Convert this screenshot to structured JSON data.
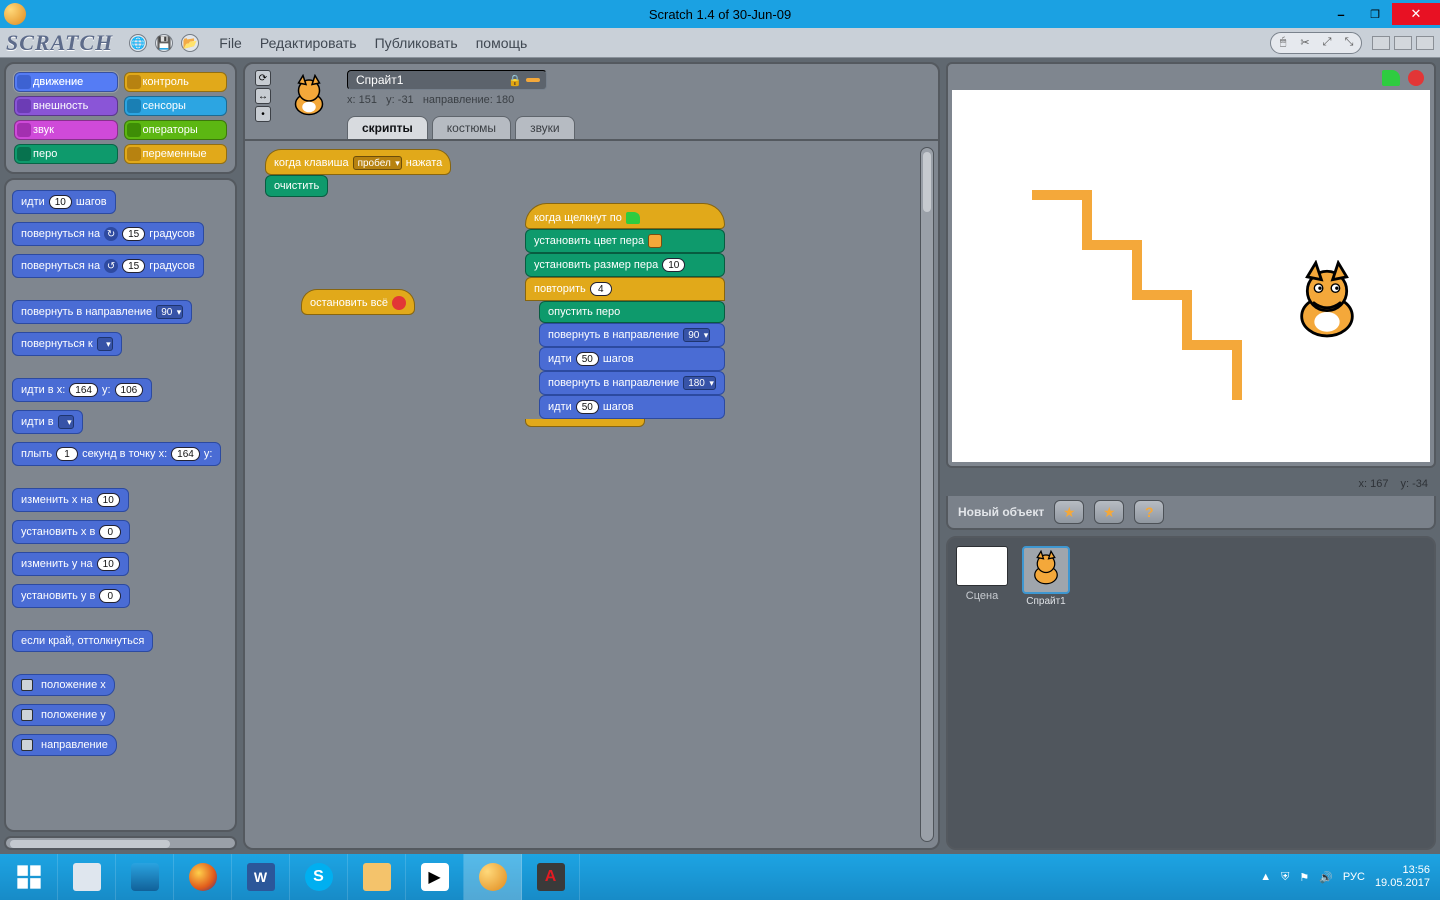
{
  "window": {
    "title": "Scratch 1.4 of 30-Jun-09"
  },
  "menu": {
    "file": "File",
    "edit": "Редактировать",
    "publish": "Публиковать",
    "help": "помощь"
  },
  "logo": "SCRATCH",
  "categories": [
    {
      "label": "движение",
      "bg": "#4a6cd4",
      "chip": "#3555b7",
      "active": true
    },
    {
      "label": "контроль",
      "bg": "#e1a91a",
      "chip": "#b78210"
    },
    {
      "label": "внешность",
      "bg": "#8a55d7",
      "chip": "#6c3cb5"
    },
    {
      "label": "сенсоры",
      "bg": "#2ca5e2",
      "chip": "#1a7fb4"
    },
    {
      "label": "звук",
      "bg": "#cf4ad9",
      "chip": "#a32fb0"
    },
    {
      "label": "операторы",
      "bg": "#5cb712",
      "chip": "#3e8d06"
    },
    {
      "label": "перо",
      "bg": "#0e9a6c",
      "chip": "#07724e"
    },
    {
      "label": "переменные",
      "bg": "#e1a91a",
      "chip": "#b78210"
    }
  ],
  "palette": {
    "move_steps": {
      "pre": "идти",
      "val": "10",
      "post": "шагов"
    },
    "turn_cw": {
      "pre": "повернуться на",
      "val": "15",
      "post": "градусов"
    },
    "turn_ccw": {
      "pre": "повернуться на",
      "val": "15",
      "post": "градусов"
    },
    "point_dir": {
      "pre": "повернуть в направление",
      "val": "90"
    },
    "point_towards": {
      "pre": "повернуться к",
      "dd": " "
    },
    "goto_xy": {
      "pre": "идти в x:",
      "x": "164",
      "mid": "y:",
      "y": "106"
    },
    "goto": {
      "pre": "идти в",
      "dd": " "
    },
    "glide": {
      "pre": "плыть",
      "sec": "1",
      "mid": "секунд в точку x:",
      "x": "164",
      "end": "y:"
    },
    "change_x": {
      "pre": "изменить x на",
      "val": "10"
    },
    "set_x": {
      "pre": "установить x в",
      "val": "0"
    },
    "change_y": {
      "pre": "изменить y на",
      "val": "10"
    },
    "set_y": {
      "pre": "установить y в",
      "val": "0"
    },
    "bounce": {
      "txt": "если край, оттолкнуться"
    },
    "rep_x": {
      "txt": "положение x"
    },
    "rep_y": {
      "txt": "положение y"
    },
    "rep_dir": {
      "txt": "направление"
    }
  },
  "sprite": {
    "name": "Спрайт1",
    "x": "151",
    "y": "-31",
    "dir": "180",
    "coord_tpl_x": "x:",
    "coord_tpl_y": "y:",
    "coord_tpl_dir": "направление:"
  },
  "tabs": {
    "scripts": "скрипты",
    "costumes": "костюмы",
    "sounds": "звуки"
  },
  "scripts": {
    "s1": {
      "hat_pre": "когда клавиша",
      "hat_dd": "пробел",
      "hat_post": "нажата",
      "clear": "очистить"
    },
    "s2": {
      "stop": "остановить всё"
    },
    "s3": {
      "hat": "когда щелкнут по",
      "setcolor": "установить цвет пера",
      "setsize_pre": "установить размер пера",
      "setsize_val": "10",
      "repeat_pre": "повторить",
      "repeat_val": "4",
      "pendown": "опустить перо",
      "point_pre": "повернуть в направление",
      "point1": "90",
      "point2": "180",
      "move_pre": "идти",
      "move_val": "50",
      "move_post": "шагов"
    }
  },
  "stage": {
    "mouse_x_lbl": "x:",
    "mouse_x": "167",
    "mouse_y_lbl": "y:",
    "mouse_y": "-34"
  },
  "new_obj": {
    "label": "Новый объект"
  },
  "scene": {
    "label": "Сцена"
  },
  "sprite_tile": {
    "name": "Спрайт1"
  },
  "tray": {
    "lang": "РУС",
    "time": "13:56",
    "date": "19.05.2017"
  }
}
